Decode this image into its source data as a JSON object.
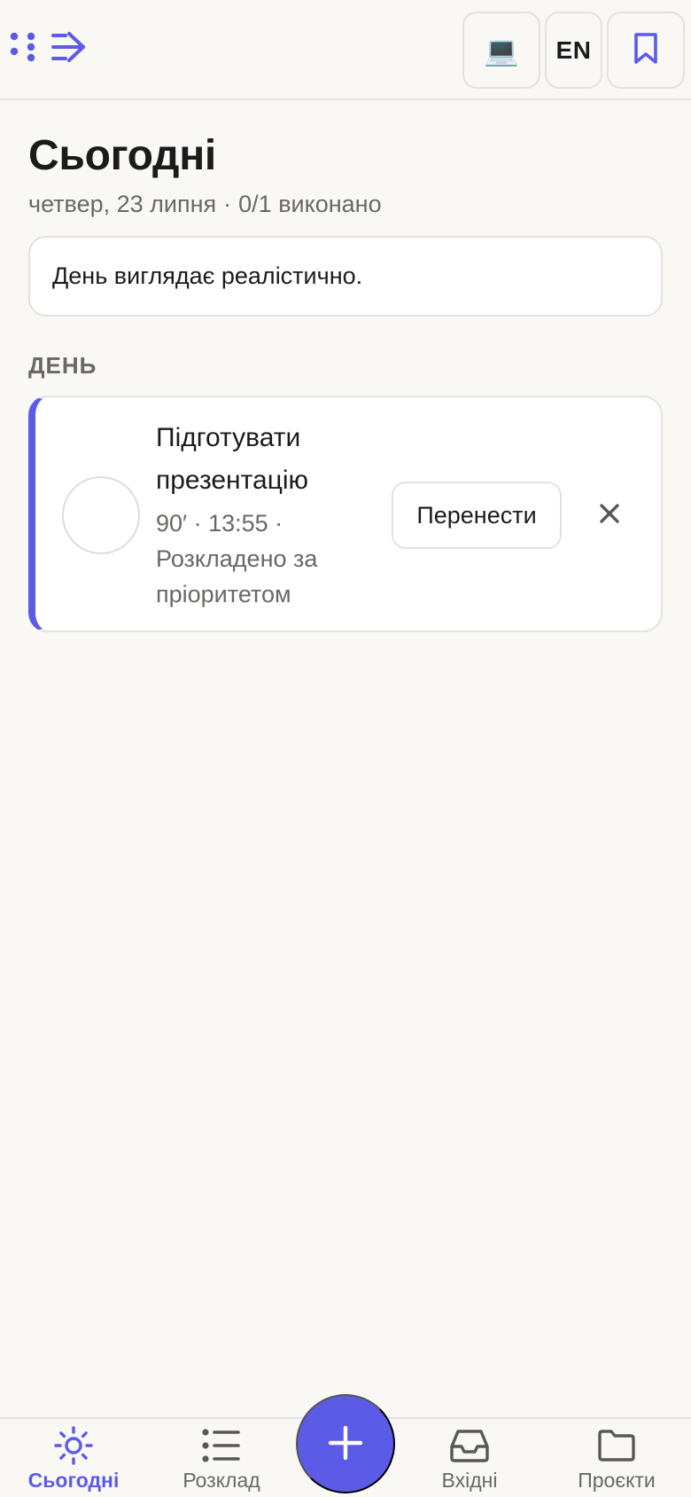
{
  "colors": {
    "accent": "#5b5be8",
    "background": "#f9f8f5",
    "card": "#ffffff",
    "muted_text": "#6a6864",
    "border": "#e3e2df"
  },
  "header": {
    "logo_icon": "app-logo-icon",
    "device_icon": "💻",
    "lang_label": "EN",
    "bookmark_icon": "bookmark-icon"
  },
  "page": {
    "title": "Сьогодні",
    "date": "четвер, 23 липня",
    "separator": "·",
    "progress": "0/1 виконано"
  },
  "summary": {
    "text": "День виглядає реалістично."
  },
  "section": {
    "label": "ДЕНЬ"
  },
  "tasks": [
    {
      "title": "Підготувати презентацію",
      "meta": "90′ · 13:55 · Розкладено за пріоритетом",
      "done": false,
      "reschedule_label": "Перенести",
      "remove_icon": "close-icon"
    }
  ],
  "bottom_nav": {
    "items": [
      {
        "label": "Сьогодні",
        "icon": "sun-icon",
        "active": true
      },
      {
        "label": "Розклад",
        "icon": "list-icon",
        "active": false
      },
      {
        "label": "Вхідні",
        "icon": "inbox-icon",
        "active": false
      },
      {
        "label": "Проєкти",
        "icon": "folder-icon",
        "active": false
      }
    ],
    "fab_icon": "plus-icon"
  }
}
